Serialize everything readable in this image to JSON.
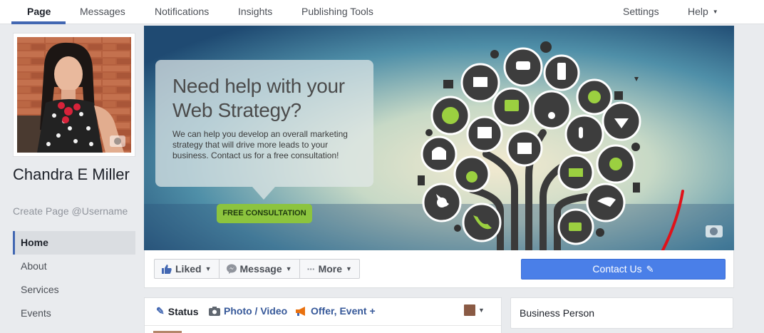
{
  "nav": {
    "tabs": [
      {
        "label": "Page"
      },
      {
        "label": "Messages"
      },
      {
        "label": "Notifications"
      },
      {
        "label": "Insights"
      },
      {
        "label": "Publishing Tools"
      }
    ],
    "settings_label": "Settings",
    "help_label": "Help"
  },
  "profile": {
    "name": "Chandra E Miller",
    "username_prompt": "Create Page @Username"
  },
  "sidebar": {
    "items": [
      {
        "label": "Home"
      },
      {
        "label": "About"
      },
      {
        "label": "Services"
      },
      {
        "label": "Events"
      }
    ]
  },
  "cover": {
    "heading": "Need help with your Web Strategy?",
    "body": "We can help you develop an overall marketing strategy that will drive more leads to your business. Contact us for a free consultation!",
    "cta_label": "FREE CONSULTATION"
  },
  "actions": {
    "liked_label": "Liked",
    "message_label": "Message",
    "more_label": "More",
    "contact_label": "Contact Us"
  },
  "composer": {
    "status_label": "Status",
    "photo_label": "Photo / Video",
    "offer_label": "Offer, Event +"
  },
  "right_card": {
    "category": "Business Person"
  },
  "colors": {
    "facebook_blue": "#4267b2",
    "contact_button": "#4a7fe8",
    "cta_green": "#8cc43e",
    "annotation_red": "#e0121a"
  },
  "icons": [
    "camera-icon",
    "thumbs-up-icon",
    "messenger-icon",
    "ellipsis-icon",
    "pencil-icon",
    "photo-icon",
    "megaphone-icon",
    "chevron-down-icon"
  ]
}
